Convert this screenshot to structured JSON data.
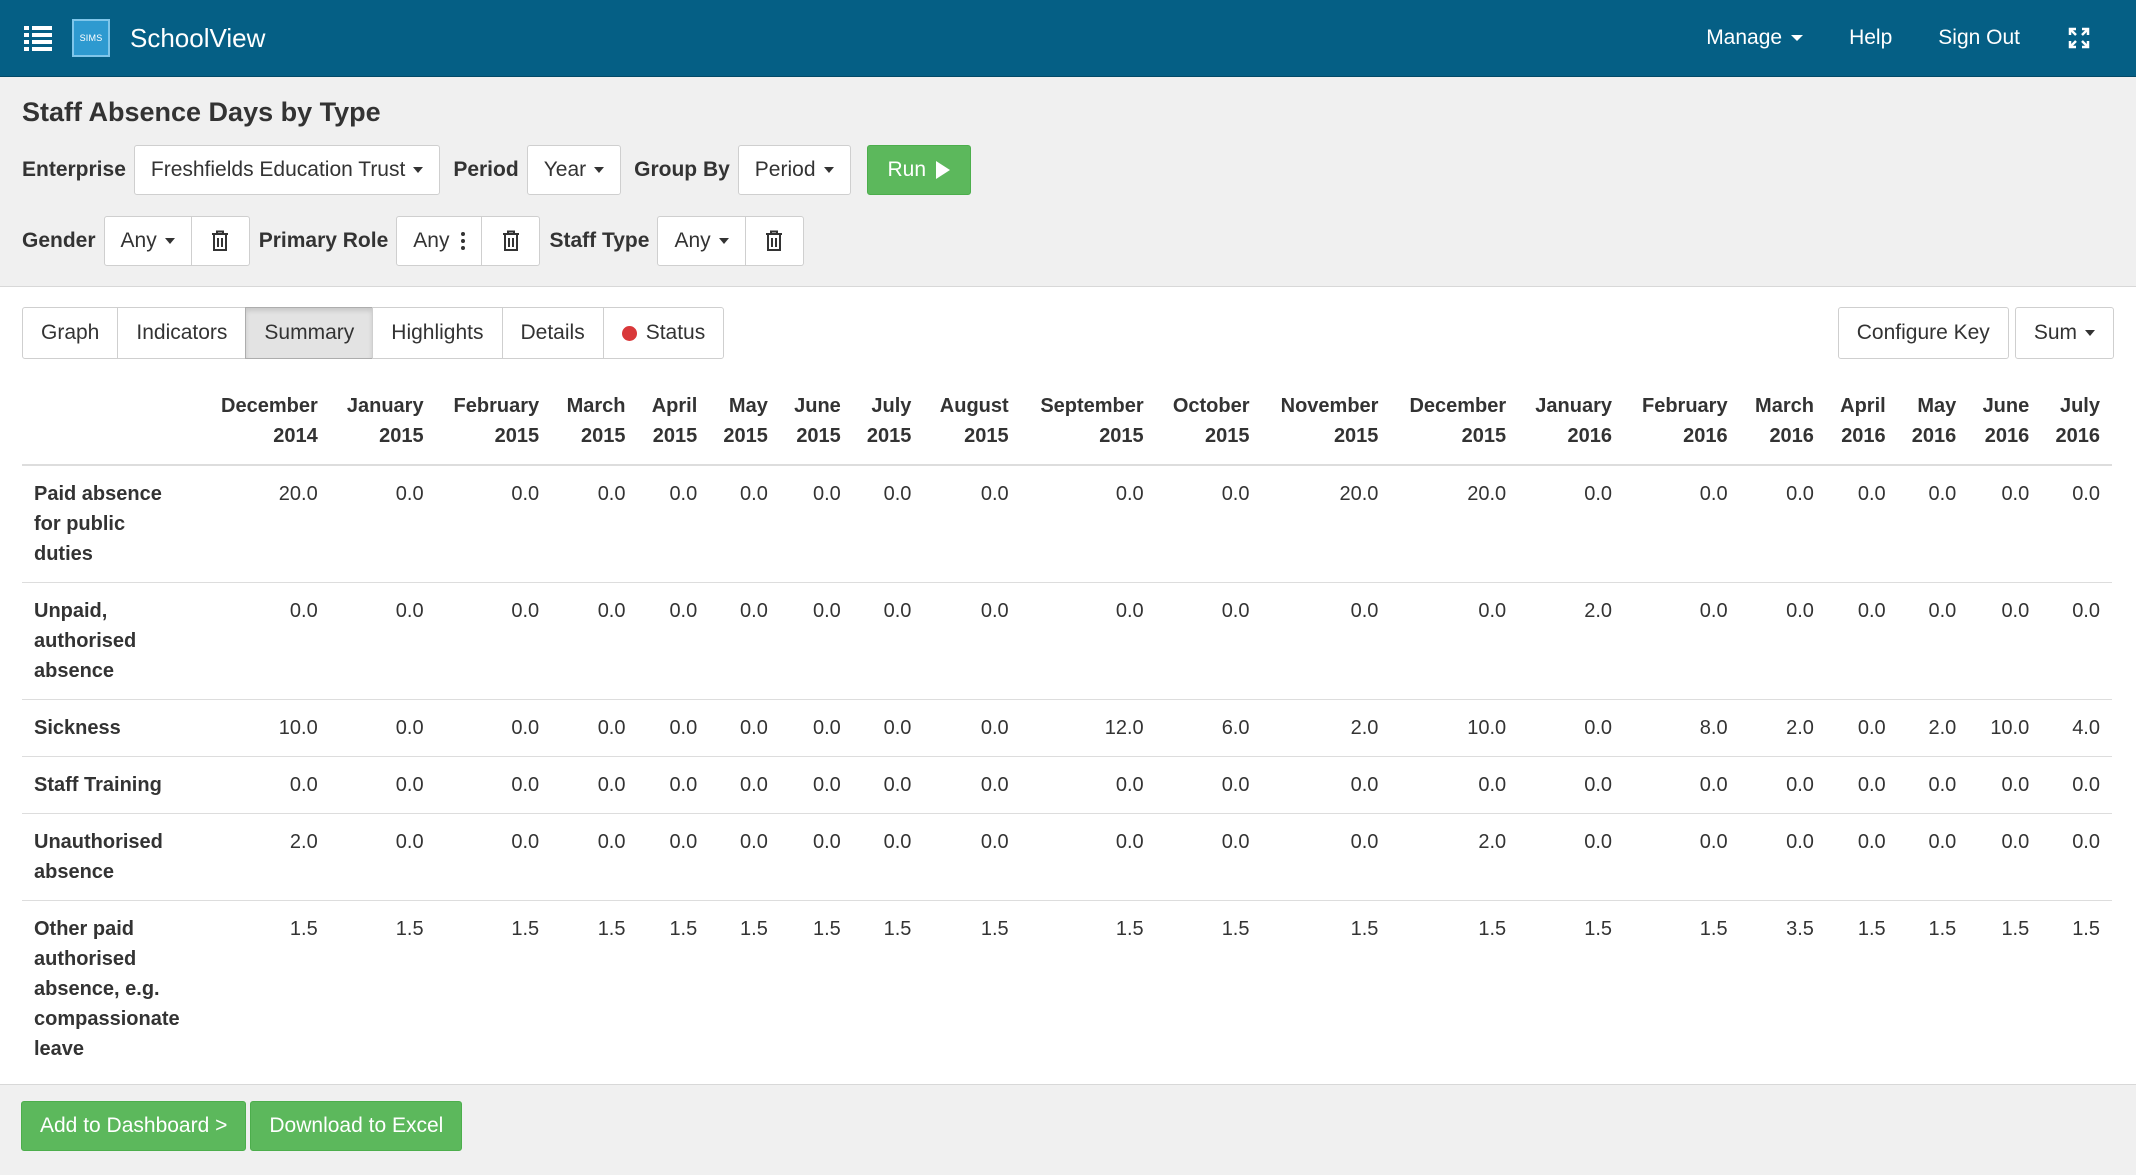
{
  "app": {
    "logo_text": "SIMS",
    "brand": "SchoolView",
    "nav": {
      "manage": "Manage",
      "help": "Help",
      "sign_out": "Sign Out"
    },
    "colors": {
      "navbar": "#055f85",
      "success": "#5cb85c",
      "status_red": "#d9383a"
    }
  },
  "report": {
    "title": "Staff Absence Days by Type",
    "filters": {
      "enterprise_label": "Enterprise",
      "enterprise_value": "Freshfields Education Trust",
      "period_label": "Period",
      "period_value": "Year",
      "groupby_label": "Group By",
      "groupby_value": "Period",
      "run_label": "Run",
      "gender_label": "Gender",
      "gender_value": "Any",
      "primary_role_label": "Primary Role",
      "primary_role_value": "Any",
      "staff_type_label": "Staff Type",
      "staff_type_value": "Any"
    },
    "tabs": [
      {
        "label": "Graph",
        "active": false
      },
      {
        "label": "Indicators",
        "active": false
      },
      {
        "label": "Summary",
        "active": true
      },
      {
        "label": "Highlights",
        "active": false
      },
      {
        "label": "Details",
        "active": false
      },
      {
        "label": "Status",
        "active": false,
        "icon": "status-dot-red"
      }
    ],
    "configure_key": "Configure Key",
    "aggregate": "Sum"
  },
  "table": {
    "columns": [
      [
        "December",
        "2014"
      ],
      [
        "January",
        "2015"
      ],
      [
        "February",
        "2015"
      ],
      [
        "March",
        "2015"
      ],
      [
        "April",
        "2015"
      ],
      [
        "May",
        "2015"
      ],
      [
        "June",
        "2015"
      ],
      [
        "July",
        "2015"
      ],
      [
        "August",
        "2015"
      ],
      [
        "September",
        "2015"
      ],
      [
        "October",
        "2015"
      ],
      [
        "November",
        "2015"
      ],
      [
        "December",
        "2015"
      ],
      [
        "January",
        "2016"
      ],
      [
        "February",
        "2016"
      ],
      [
        "March",
        "2016"
      ],
      [
        "April",
        "2016"
      ],
      [
        "May",
        "2016"
      ],
      [
        "June",
        "2016"
      ],
      [
        "July",
        "2016"
      ]
    ],
    "rows": [
      {
        "label": [
          "Paid absence",
          "for public",
          "duties"
        ],
        "values": [
          "20.0",
          "0.0",
          "0.0",
          "0.0",
          "0.0",
          "0.0",
          "0.0",
          "0.0",
          "0.0",
          "0.0",
          "0.0",
          "20.0",
          "20.0",
          "0.0",
          "0.0",
          "0.0",
          "0.0",
          "0.0",
          "0.0",
          "0.0"
        ]
      },
      {
        "label": [
          "Unpaid,",
          "authorised",
          "absence"
        ],
        "values": [
          "0.0",
          "0.0",
          "0.0",
          "0.0",
          "0.0",
          "0.0",
          "0.0",
          "0.0",
          "0.0",
          "0.0",
          "0.0",
          "0.0",
          "0.0",
          "2.0",
          "0.0",
          "0.0",
          "0.0",
          "0.0",
          "0.0",
          "0.0"
        ]
      },
      {
        "label": [
          "Sickness"
        ],
        "values": [
          "10.0",
          "0.0",
          "0.0",
          "0.0",
          "0.0",
          "0.0",
          "0.0",
          "0.0",
          "0.0",
          "12.0",
          "6.0",
          "2.0",
          "10.0",
          "0.0",
          "8.0",
          "2.0",
          "0.0",
          "2.0",
          "10.0",
          "4.0"
        ]
      },
      {
        "label": [
          "Staff Training"
        ],
        "values": [
          "0.0",
          "0.0",
          "0.0",
          "0.0",
          "0.0",
          "0.0",
          "0.0",
          "0.0",
          "0.0",
          "0.0",
          "0.0",
          "0.0",
          "0.0",
          "0.0",
          "0.0",
          "0.0",
          "0.0",
          "0.0",
          "0.0",
          "0.0"
        ]
      },
      {
        "label": [
          "Unauthorised",
          "absence"
        ],
        "values": [
          "2.0",
          "0.0",
          "0.0",
          "0.0",
          "0.0",
          "0.0",
          "0.0",
          "0.0",
          "0.0",
          "0.0",
          "0.0",
          "0.0",
          "2.0",
          "0.0",
          "0.0",
          "0.0",
          "0.0",
          "0.0",
          "0.0",
          "0.0"
        ]
      },
      {
        "label": [
          "Other paid",
          "authorised",
          "absence, e.g.",
          "compassionate",
          "leave"
        ],
        "values": [
          "1.5",
          "1.5",
          "1.5",
          "1.5",
          "1.5",
          "1.5",
          "1.5",
          "1.5",
          "1.5",
          "1.5",
          "1.5",
          "1.5",
          "1.5",
          "1.5",
          "1.5",
          "3.5",
          "1.5",
          "1.5",
          "1.5",
          "1.5"
        ]
      }
    ]
  },
  "footer": {
    "add_dashboard": "Add to Dashboard >",
    "download_excel": "Download to Excel"
  }
}
